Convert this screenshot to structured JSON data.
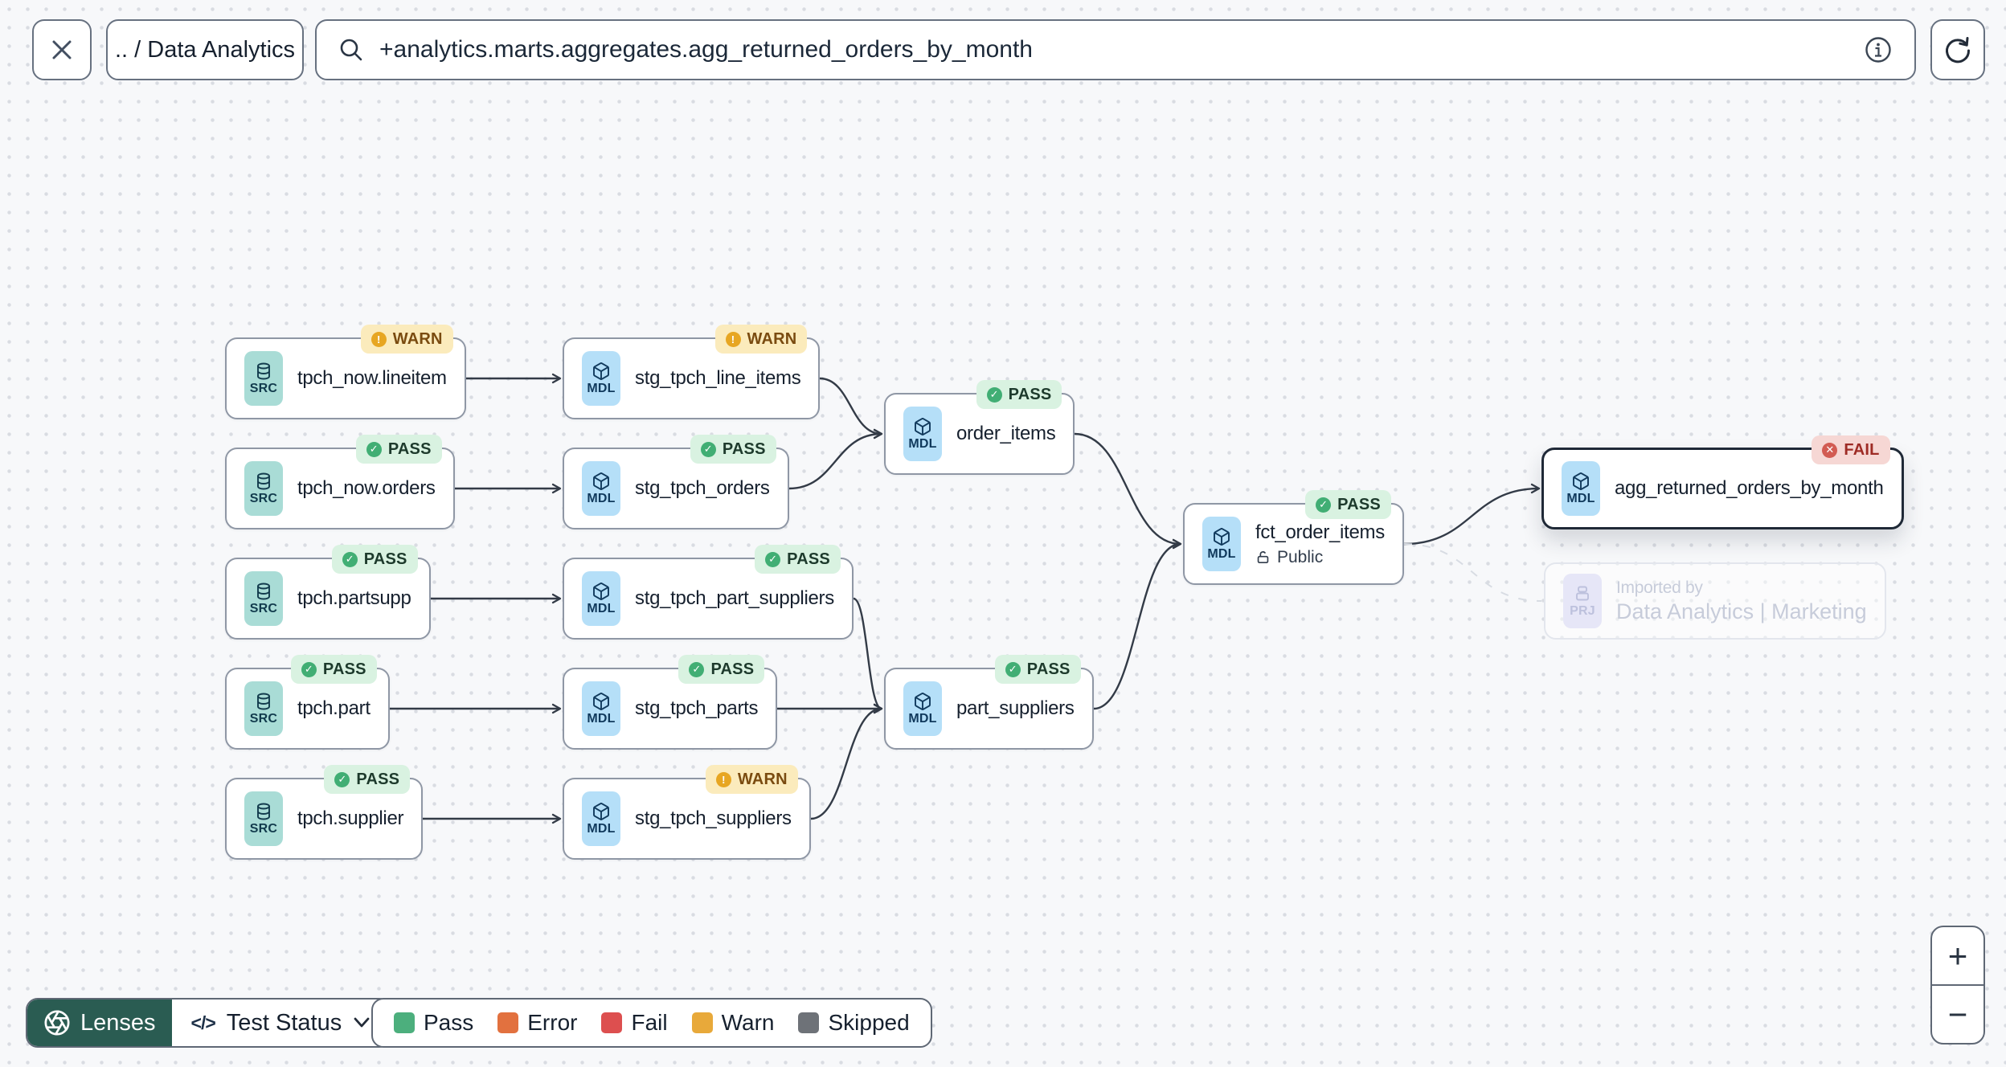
{
  "topbar": {
    "breadcrumb": ".. / Data Analytics",
    "search_value": "+analytics.marts.aggregates.agg_returned_orders_by_month"
  },
  "icons": {
    "plus": "+",
    "minus": "−",
    "code": "</>"
  },
  "graph": {
    "nodes": [
      {
        "id": "tpch_now_lineitem",
        "kind": "SRC",
        "label": "tpch_now.lineitem",
        "status": "WARN"
      },
      {
        "id": "stg_tpch_line_items",
        "kind": "MDL",
        "label": "stg_tpch_line_items",
        "status": "WARN"
      },
      {
        "id": "tpch_now_orders",
        "kind": "SRC",
        "label": "tpch_now.orders",
        "status": "PASS"
      },
      {
        "id": "stg_tpch_orders",
        "kind": "MDL",
        "label": "stg_tpch_orders",
        "status": "PASS"
      },
      {
        "id": "tpch_partsupp",
        "kind": "SRC",
        "label": "tpch.partsupp",
        "status": "PASS"
      },
      {
        "id": "stg_tpch_part_suppliers",
        "kind": "MDL",
        "label": "stg_tpch_part_suppliers",
        "status": "PASS"
      },
      {
        "id": "tpch_part",
        "kind": "SRC",
        "label": "tpch.part",
        "status": "PASS"
      },
      {
        "id": "stg_tpch_parts",
        "kind": "MDL",
        "label": "stg_tpch_parts",
        "status": "PASS"
      },
      {
        "id": "tpch_supplier",
        "kind": "SRC",
        "label": "tpch.supplier",
        "status": "PASS"
      },
      {
        "id": "stg_tpch_suppliers",
        "kind": "MDL",
        "label": "stg_tpch_suppliers",
        "status": "WARN"
      },
      {
        "id": "order_items",
        "kind": "MDL",
        "label": "order_items",
        "status": "PASS"
      },
      {
        "id": "part_suppliers",
        "kind": "MDL",
        "label": "part_suppliers",
        "status": "PASS"
      },
      {
        "id": "fct_order_items",
        "kind": "MDL",
        "label": "fct_order_items",
        "status": "PASS",
        "sublabel": "Public",
        "access_icon": "unlock"
      },
      {
        "id": "agg_returned_orders_by_month",
        "kind": "MDL",
        "label": "agg_returned_orders_by_month",
        "status": "FAIL",
        "selected": true
      },
      {
        "id": "imported_by",
        "kind": "PRJ",
        "label": "Imported by",
        "sublabel": "Data Analytics | Marketing",
        "ghost": true
      }
    ],
    "edges": [
      {
        "from": "tpch_now_lineitem",
        "to": "stg_tpch_line_items",
        "style": "solid"
      },
      {
        "from": "tpch_now_orders",
        "to": "stg_tpch_orders",
        "style": "solid"
      },
      {
        "from": "tpch_partsupp",
        "to": "stg_tpch_part_suppliers",
        "style": "solid"
      },
      {
        "from": "tpch_part",
        "to": "stg_tpch_parts",
        "style": "solid"
      },
      {
        "from": "tpch_supplier",
        "to": "stg_tpch_suppliers",
        "style": "solid"
      },
      {
        "from": "stg_tpch_line_items",
        "to": "order_items",
        "style": "solid"
      },
      {
        "from": "stg_tpch_orders",
        "to": "order_items",
        "style": "solid"
      },
      {
        "from": "stg_tpch_part_suppliers",
        "to": "part_suppliers",
        "style": "solid"
      },
      {
        "from": "stg_tpch_parts",
        "to": "part_suppliers",
        "style": "solid"
      },
      {
        "from": "stg_tpch_suppliers",
        "to": "part_suppliers",
        "style": "solid"
      },
      {
        "from": "order_items",
        "to": "fct_order_items",
        "style": "solid"
      },
      {
        "from": "part_suppliers",
        "to": "fct_order_items",
        "style": "solid"
      },
      {
        "from": "fct_order_items",
        "to": "agg_returned_orders_by_month",
        "style": "solid"
      },
      {
        "from": "fct_order_items",
        "to": "imported_by",
        "style": "dashed"
      }
    ],
    "status_badge_colors": {
      "PASS": "#41ae74",
      "WARN": "#e7a622",
      "FAIL": "#d25b52"
    },
    "status_badge_glyphs": {
      "PASS": "✓",
      "WARN": "!",
      "FAIL": "✕"
    }
  },
  "lenses": {
    "button_label": "Lenses",
    "active_lens": "Test Status"
  },
  "legend": {
    "items": [
      {
        "label": "Pass",
        "color": "#4caf7d"
      },
      {
        "label": "Error",
        "color": "#e2713f"
      },
      {
        "label": "Fail",
        "color": "#dd4f4f"
      },
      {
        "label": "Warn",
        "color": "#e8a93a"
      },
      {
        "label": "Skipped",
        "color": "#6e7278"
      }
    ]
  }
}
